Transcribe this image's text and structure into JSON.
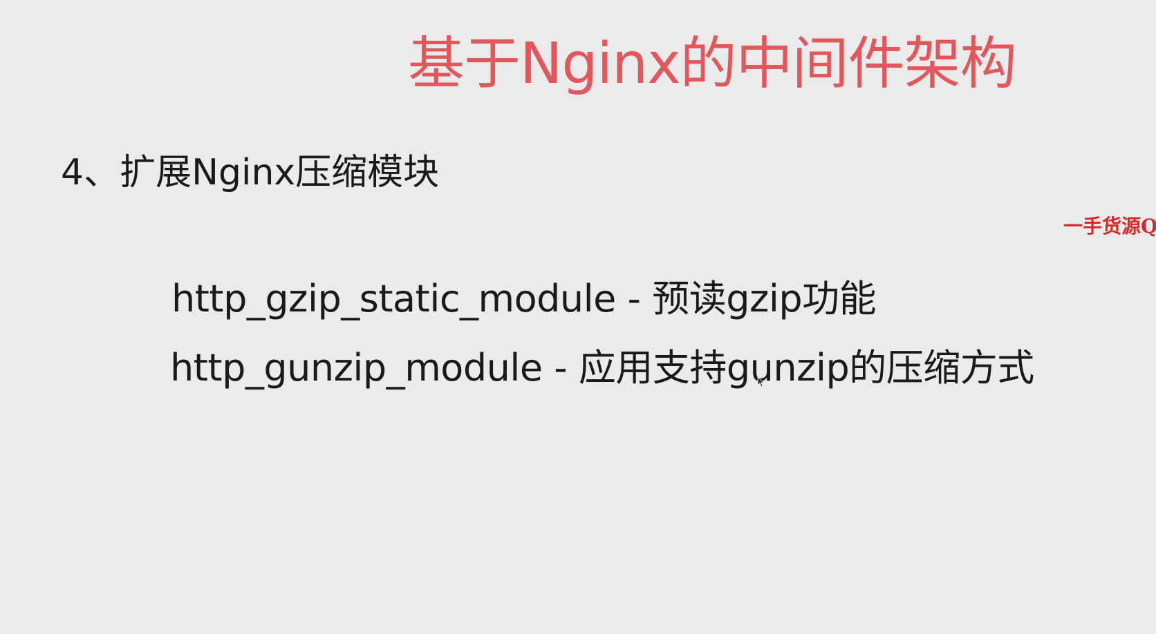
{
  "slide": {
    "title": "基于Nginx的中间件架构",
    "heading": "4、扩展Nginx压缩模块",
    "watermark": "一手货源Q",
    "items": [
      {
        "text": "http_gzip_static_module - 预读gzip功能"
      },
      {
        "text": "http_gunzip_module - 应用支持gunzip的压缩方式"
      }
    ]
  },
  "colors": {
    "background": "#ebebeb",
    "title": "#e0585c",
    "text": "#1a1a1a",
    "watermark": "#d42a2a"
  }
}
